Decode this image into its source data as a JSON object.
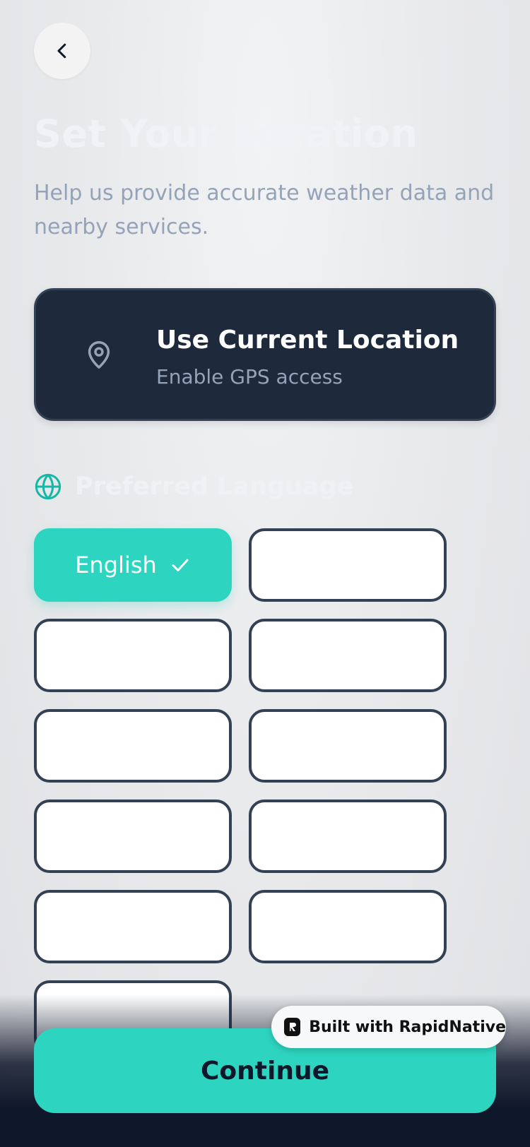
{
  "header": {
    "back_icon": "chevron-left-icon",
    "title": "Set Your Location",
    "subtitle": "Help us provide accurate weather data and nearby services."
  },
  "location_card": {
    "icon": "map-pin-icon",
    "title": "Use Current Location",
    "subtitle": "Enable GPS access"
  },
  "language_section": {
    "icon": "globe-icon",
    "title": "Preferred Language",
    "options": [
      {
        "label": "English",
        "selected": true
      },
      {
        "label": "",
        "selected": false
      },
      {
        "label": "",
        "selected": false
      },
      {
        "label": "",
        "selected": false
      },
      {
        "label": "",
        "selected": false
      },
      {
        "label": "",
        "selected": false
      },
      {
        "label": "",
        "selected": false
      },
      {
        "label": "",
        "selected": false
      },
      {
        "label": "",
        "selected": false
      },
      {
        "label": "",
        "selected": false
      },
      {
        "label": "",
        "selected": false
      }
    ]
  },
  "footer": {
    "continue_label": "Continue",
    "badge_label": "Built with RapidNative"
  },
  "colors": {
    "accent": "#2dd4bf",
    "dark": "#1e293b",
    "muted": "#94a3b8"
  }
}
